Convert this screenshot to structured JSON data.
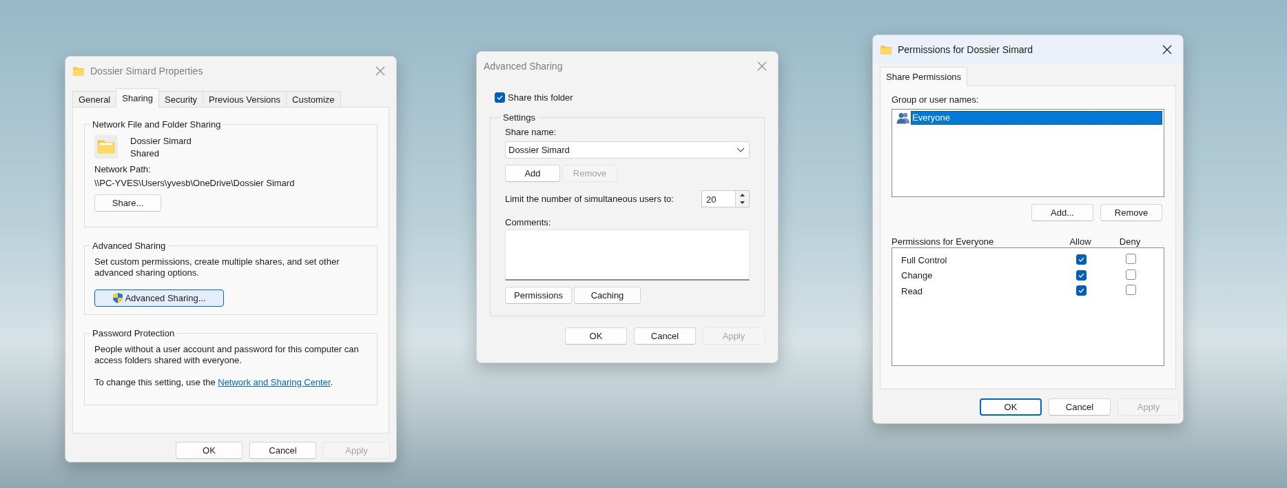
{
  "windows": [
    {
      "kind": "properties",
      "title": "Dossier Simard Properties",
      "active": false,
      "tabs": [
        {
          "label": "General",
          "selected": false
        },
        {
          "label": "Sharing",
          "selected": true
        },
        {
          "label": "Security",
          "selected": false
        },
        {
          "label": "Previous Versions",
          "selected": false
        },
        {
          "label": "Customize",
          "selected": false
        }
      ],
      "network_sharing": {
        "heading": "Network File and Folder Sharing",
        "folder_name": "Dossier Simard",
        "status": "Shared",
        "path_label": "Network Path:",
        "path": "\\\\PC-YVES\\Users\\yvesb\\OneDrive\\Dossier Simard",
        "button": {
          "label": "Share...",
          "disabled": false,
          "focused": false
        }
      },
      "advanced_sharing": {
        "heading": "Advanced Sharing",
        "description": "Set custom permissions, create multiple shares, and set other advanced sharing options.",
        "button": {
          "label": "Advanced Sharing...",
          "disabled": false,
          "focused": true
        }
      },
      "password_protection": {
        "heading": "Password Protection",
        "description": "People without a user account and password for this computer can access folders shared with everyone.",
        "change_text": "To change this setting, use the",
        "link": "Network and Sharing Center",
        "link_suffix": "."
      },
      "buttons": [
        {
          "label": "OK",
          "disabled": false,
          "focused": false
        },
        {
          "label": "Cancel",
          "disabled": false,
          "focused": false
        },
        {
          "label": "Apply",
          "disabled": true,
          "focused": false
        }
      ]
    },
    {
      "kind": "advanced_sharing",
      "title": "Advanced Sharing",
      "active": false,
      "share_checkbox": {
        "label": "Share this folder",
        "checked": true
      },
      "settings": {
        "heading": "Settings",
        "share_name_label": "Share name:",
        "share_name": "Dossier Simard",
        "name_buttons": [
          {
            "label": "Add",
            "disabled": false,
            "focused": false
          },
          {
            "label": "Remove",
            "disabled": true,
            "focused": false
          }
        ],
        "limit_label": "Limit the number of simultaneous users to:",
        "limit_value": "20",
        "comments_label": "Comments:",
        "buttons": [
          {
            "label": "Permissions",
            "disabled": false,
            "focused": false
          },
          {
            "label": "Caching",
            "disabled": false,
            "focused": false
          }
        ]
      },
      "buttons": [
        {
          "label": "OK",
          "disabled": false,
          "focused": false
        },
        {
          "label": "Cancel",
          "disabled": false,
          "focused": false
        },
        {
          "label": "Apply",
          "disabled": true,
          "focused": false
        }
      ]
    },
    {
      "kind": "permissions",
      "title": "Permissions for Dossier Simard",
      "active": true,
      "tabs": [
        {
          "label": "Share Permissions",
          "selected": true
        }
      ],
      "group_label": "Group or user names:",
      "users": [
        {
          "name": "Everyone",
          "selected": true
        }
      ],
      "user_buttons": [
        {
          "label": "Add...",
          "disabled": false,
          "focused": false
        },
        {
          "label": "Remove",
          "disabled": false,
          "focused": false
        }
      ],
      "permissions_label": "Permissions for Everyone",
      "allow_label": "Allow",
      "deny_label": "Deny",
      "permissions": [
        {
          "name": "Full Control",
          "allow": true,
          "deny": false
        },
        {
          "name": "Change",
          "allow": true,
          "deny": false
        },
        {
          "name": "Read",
          "allow": true,
          "deny": false
        }
      ],
      "buttons": [
        {
          "label": "OK",
          "disabled": false,
          "focused": true
        },
        {
          "label": "Cancel",
          "disabled": false,
          "focused": false
        },
        {
          "label": "Apply",
          "disabled": true,
          "focused": false
        }
      ]
    }
  ]
}
